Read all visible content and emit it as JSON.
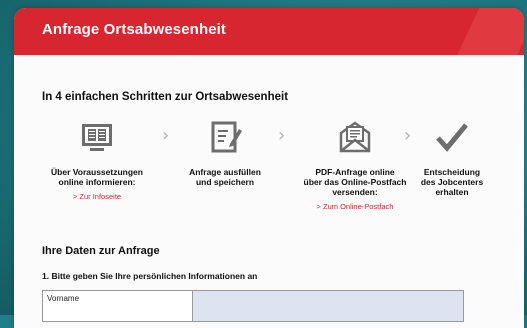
{
  "header": {
    "title": "Anfrage Ortsabwesenheit"
  },
  "intro": {
    "heading": "In 4 einfachen Schritten zur Ortsabwesenheit"
  },
  "steps": [
    {
      "icon": "book-screen-icon",
      "label_line1": "Über Voraussetzungen",
      "label_line2": "online informieren:",
      "label_line3": "",
      "link": "> Zur Infoseite"
    },
    {
      "icon": "edit-form-icon",
      "label_line1": "Anfrage ausfüllen",
      "label_line2": "und speichern",
      "label_line3": "",
      "link": ""
    },
    {
      "icon": "mail-envelope-icon",
      "label_line1": "PDF-Anfrage online",
      "label_line2": "über das Online-Postfach",
      "label_line3": "versenden:",
      "link": "> Zum Online-Postfach"
    },
    {
      "icon": "checkmark-icon",
      "label_line1": "Entscheidung",
      "label_line2": "des Jobcenters",
      "label_line3": "erhalten",
      "link": ""
    }
  ],
  "section": {
    "title": "Ihre Daten zur Anfrage",
    "subtitle": "1. Bitte geben Sie Ihre persönlichen Informationen an"
  },
  "form": {
    "first_name_label": "Vorname",
    "first_name_value": ""
  },
  "colors": {
    "brand_red": "#d7262f",
    "background_teal": "#1e7f86",
    "input_blue": "#dbe4f0"
  }
}
